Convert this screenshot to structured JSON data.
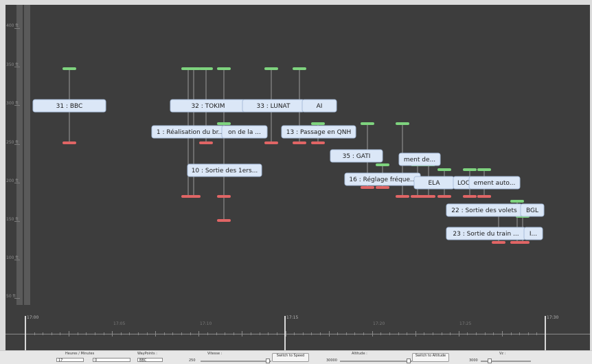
{
  "y_axis": {
    "labels": [
      "400 ft",
      "350 ft",
      "300 ft",
      "250 ft",
      "200 ft",
      "150 ft",
      "100 ft",
      "50 ft"
    ]
  },
  "timeline": {
    "major_labels": [
      "17:00",
      "17:15",
      "17:30"
    ],
    "minor_labels": [
      "17:05",
      "17:10",
      "17:20",
      "17:25"
    ]
  },
  "waypoints": [
    {
      "label": "31 : BBC",
      "pos": "front"
    },
    {
      "label": "32 : TOKIM",
      "pos": "front"
    },
    {
      "label": "33 : LUNAT",
      "pos": "front"
    },
    {
      "label": "AI",
      "pos": "back"
    },
    {
      "label": "1 : Réalisation du br...",
      "pos": "front"
    },
    {
      "label": "on de la ...",
      "pos": "back"
    },
    {
      "label": "13 : Passage en QNH",
      "pos": "front"
    },
    {
      "label": "10 : Sortie des 1ers...",
      "pos": "front"
    },
    {
      "label": "35 : GATI",
      "pos": "front"
    },
    {
      "label": "ment de...",
      "pos": "back"
    },
    {
      "label": "16 : Réglage fréque...",
      "pos": "front"
    },
    {
      "label": "ELA",
      "pos": "back"
    },
    {
      "label": "LOC",
      "pos": "back"
    },
    {
      "label": "ement auto...",
      "pos": "back"
    },
    {
      "label": "22 : Sortie des volets",
      "pos": "front"
    },
    {
      "label": "BGL",
      "pos": "back"
    },
    {
      "label": "23 : Sortie du train ...",
      "pos": "front"
    },
    {
      "label": "I...",
      "pos": "back"
    }
  ],
  "controls": {
    "hours_minutes_label": "Heures / Minutes",
    "hours_value": "17",
    "minutes_value": "0",
    "waypoints_label": "WayPoints :",
    "waypoints_value": "BBC",
    "speed_label": "Vitesse :",
    "speed_value": "250",
    "switch_speed": "Switch to Speed",
    "altitude_label": "Altitude :",
    "altitude_value": "30000",
    "switch_altitude": "Switch to Altitude",
    "vz_label": "Vz :",
    "vz_value": "3000"
  },
  "colors": {
    "background": "#3d3d3d",
    "green_marker": "#7ed37e",
    "red_marker": "#e06565",
    "label_fill": "#dbe7f7"
  }
}
